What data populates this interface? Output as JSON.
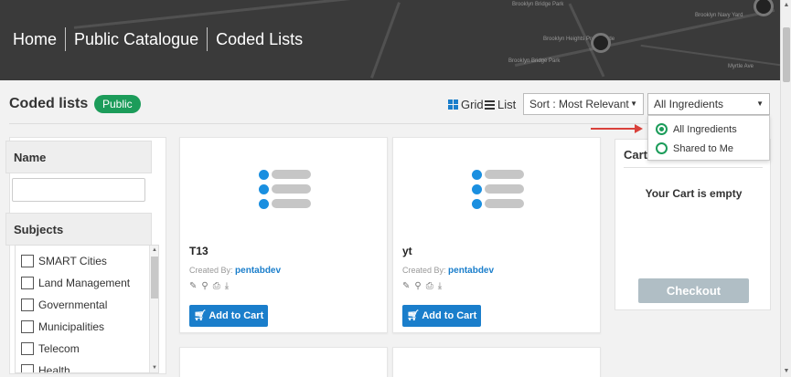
{
  "header": {
    "breadcrumbs": [
      "Home",
      "Public Catalogue",
      "Coded Lists"
    ],
    "map_labels": [
      "Brooklyn Bridge Park",
      "Brooklyn Navy Yard",
      "Brooklyn Heights Promenade",
      "Brooklyn Bridge Park",
      "Myrtle Ave"
    ]
  },
  "page": {
    "title": "Coded lists",
    "badge": "Public",
    "grid_label": "Grid",
    "list_label": "List",
    "sort_value": "Sort : Most Relevant",
    "filter_value": "All Ingredients"
  },
  "dropdown": {
    "options": [
      "All Ingredients",
      "Shared to Me"
    ],
    "selected": "All Ingredients"
  },
  "sidebar": {
    "name_header": "Name",
    "subjects_header": "Subjects",
    "subjects": [
      "SMART Cities",
      "Land Management",
      "Governmental",
      "Municipalities",
      "Telecom",
      "Health"
    ]
  },
  "cards": [
    {
      "name": "T13",
      "created_by_label": "Created By:",
      "author": "pentabdev",
      "button": "Add to Cart"
    },
    {
      "name": "yt",
      "created_by_label": "Created By:",
      "author": "pentabdev",
      "button": "Add to Cart"
    }
  ],
  "cart": {
    "title": "Cart",
    "empty_text": "Your Cart is empty",
    "checkout": "Checkout"
  },
  "colors": {
    "accent_blue": "#1a7ecb",
    "badge_green": "#1c9c5a",
    "annotation_red": "#d9413b"
  }
}
